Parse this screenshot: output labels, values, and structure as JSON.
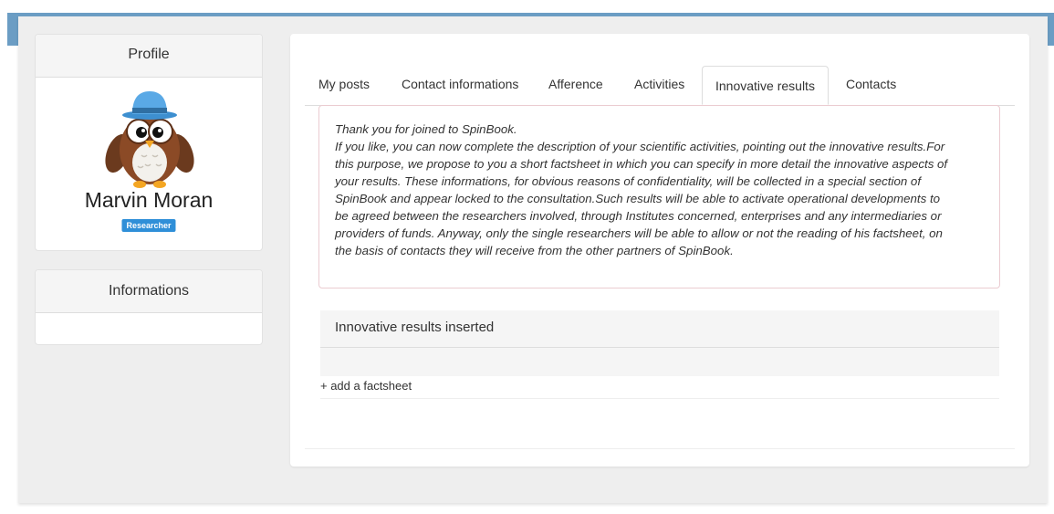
{
  "sidebar": {
    "profile": {
      "heading": "Profile",
      "name": "Marvin Moran",
      "role": "Researcher"
    },
    "informations": {
      "heading": "Informations"
    }
  },
  "tabs": [
    {
      "label": "My posts",
      "active": false
    },
    {
      "label": "Contact informations",
      "active": false
    },
    {
      "label": "Afference",
      "active": false
    },
    {
      "label": "Activities",
      "active": false
    },
    {
      "label": "Innovative results",
      "active": true
    },
    {
      "label": "Contacts",
      "active": false
    }
  ],
  "notice": {
    "lines": [
      "Thank you for joined to SpinBook.",
      "If you like, you can now complete the description of your scientific activities, pointing out the innovative results.For",
      "this purpose, we propose to you a short factsheet in which you can specify in more detail the innovative aspects of",
      "your results. These informations, for obvious reasons of confidentiality, will be collected in a special section of",
      "SpinBook and appear locked to the consultation.Such results will be able to activate operational developments to",
      "be agreed between the researchers involved, through Institutes concerned, enterprises and any intermediaries or",
      "providers of funds. Anyway, only the single researchers will be able to allow or not the reading of his factsheet, on",
      "the basis of contacts they will receive from the other partners of SpinBook."
    ]
  },
  "results": {
    "heading": "Innovative results inserted",
    "add_link": "+ add a factsheet"
  },
  "colors": {
    "topbar": "#6b9dc4",
    "badge": "#2f8fd8",
    "notice_border": "#ebccd1",
    "hat": "#5aa9e6"
  }
}
